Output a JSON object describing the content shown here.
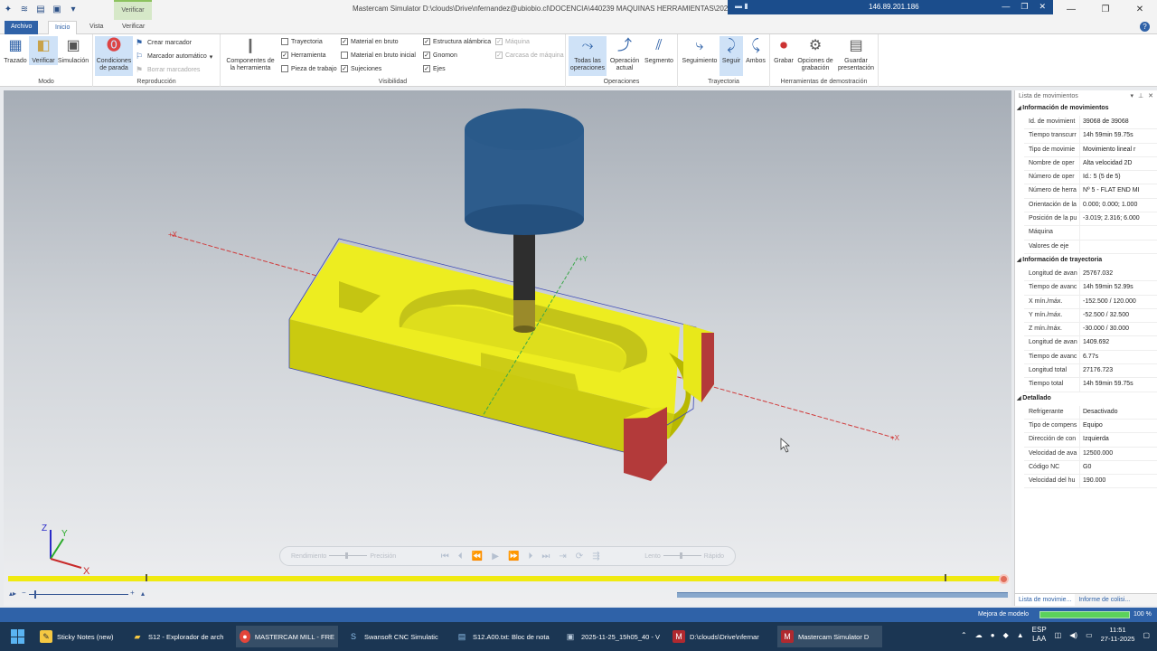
{
  "titlebar": {
    "title": "Mastercam Simulator  D:\\clouds\\Drive\\nfernandez@ubiobio.cl\\DOCENCIA\\440239 MAQUINAS HERRAMIENTAS\\2025",
    "context_group": "Verificar",
    "remote_ip": "146.89.201.186"
  },
  "tabs": {
    "file": "Archivo",
    "home": "Inicio",
    "view": "Vista",
    "verify": "Verificar"
  },
  "ribbon": {
    "mode": {
      "label": "Modo",
      "path": "Trazado",
      "verify": "Verificar",
      "simulation": "Simulación"
    },
    "playback": {
      "label": "Reproducción",
      "stop_conditions": "Condiciones de parada",
      "create_marker": "Crear marcador",
      "auto_marker": "Marcador automático",
      "delete_markers": "Borrar marcadores"
    },
    "visibility": {
      "label": "Visibilidad",
      "tool_components": "Componentes de la herramienta",
      "toolpath": "Trayectoria",
      "tool": "Herramienta",
      "workpiece": "Pieza de trabajo",
      "stock": "Material en bruto",
      "initial_stock": "Material en bruto inicial",
      "fixtures": "Sujeciones",
      "wireframe": "Estructura alámbrica",
      "gnomon": "Gnomon",
      "axes": "Ejes",
      "machine": "Máquina",
      "machine_housing": "Carcasa de máquina"
    },
    "operations": {
      "label": "Operaciones",
      "all_ops": "Todas las operaciones",
      "current_op": "Operación actual",
      "segment": "Segmento"
    },
    "toolpath": {
      "label": "Trayectoria",
      "tracking": "Seguimiento",
      "follow": "Seguir",
      "both": "Ambos"
    },
    "demo": {
      "label": "Herramientas de demostración",
      "record": "Grabar",
      "record_options": "Opciones de grabación",
      "save_presentation": "Guardar presentación"
    }
  },
  "playbar": {
    "performance": "Rendimiento",
    "precision": "Precisión",
    "slow": "Lento",
    "fast": "Rápido"
  },
  "axis_labels": {
    "x": "X",
    "y": "Y",
    "z": "Z",
    "plus_x": "+X",
    "plus_y": "+Y"
  },
  "panel": {
    "title": "Lista de movimientos",
    "sections": [
      {
        "title": "Información de movimientos",
        "rows": [
          {
            "k": "Id. de movimient",
            "v": "39068 de 39068"
          },
          {
            "k": "Tiempo transcurr",
            "v": "14h 59min 59.75s"
          },
          {
            "k": "Tipo de movimie",
            "v": "Movimiento lineal r"
          },
          {
            "k": "Nombre de oper",
            "v": "Alta velocidad 2D"
          },
          {
            "k": "Número de oper",
            "v": "Id.: 5 (5 de 5)"
          },
          {
            "k": "Número de herra",
            "v": "Nº 5 - FLAT END MI"
          },
          {
            "k": "Orientación de la",
            "v": "0.000; 0.000; 1.000"
          },
          {
            "k": "Posición de la pu",
            "v": "-3.019; 2.316; 6.000"
          },
          {
            "k": "Máquina",
            "v": ""
          },
          {
            "k": "Valores de eje",
            "v": ""
          }
        ]
      },
      {
        "title": "Información de trayectoria",
        "rows": [
          {
            "k": "Longitud de avan",
            "v": "25767.032"
          },
          {
            "k": "Tiempo de avanc",
            "v": "14h 59min 52.99s"
          },
          {
            "k": "X mín./máx.",
            "v": "-152.500 / 120.000"
          },
          {
            "k": "Y mín./máx.",
            "v": "-52.500 / 32.500"
          },
          {
            "k": "Z mín./máx.",
            "v": "-30.000 / 30.000"
          },
          {
            "k": "Longitud de avan",
            "v": "1409.692"
          },
          {
            "k": "Tiempo de avanc",
            "v": "6.77s"
          },
          {
            "k": "Longitud total",
            "v": "27176.723"
          },
          {
            "k": "Tiempo total",
            "v": "14h 59min 59.75s"
          }
        ]
      },
      {
        "title": "Detallado",
        "rows": [
          {
            "k": "Refrigerante",
            "v": "Desactivado"
          },
          {
            "k": "Tipo de compens",
            "v": "Equipo"
          },
          {
            "k": "Dirección de con",
            "v": "Izquierda"
          },
          {
            "k": "Velocidad de ava",
            "v": "12500.000"
          },
          {
            "k": "Código NC",
            "v": "G0"
          },
          {
            "k": "Velocidad del hu",
            "v": "190.000"
          }
        ]
      }
    ],
    "tab_moves": "Lista de movimie...",
    "tab_collision": "Informe de colisi..."
  },
  "status": {
    "label": "Mejora de modelo",
    "progress": 1.0,
    "percent": "100 %"
  },
  "taskbar": {
    "items": [
      "Sticky Notes (new)",
      "S12 - Explorador de arch",
      "MASTERCAM MILL - FRE",
      "Swansoft CNC Simulatic",
      "S12.A00.txt: Bloc de nota",
      "2025-11-25_15h05_40 - V",
      "D:\\clouds\\Drive\\nfernar",
      "Mastercam Simulator  D"
    ],
    "lang": "ESP",
    "lang2": "LAA",
    "time": "11:51",
    "date": "27-11-2025"
  },
  "colors": {
    "accent": "#2f62a8",
    "part": "#e8e81a",
    "tool_holder": "#2d5c8c",
    "fixture": "#b33a3a",
    "timeline": "#f0ea10"
  }
}
